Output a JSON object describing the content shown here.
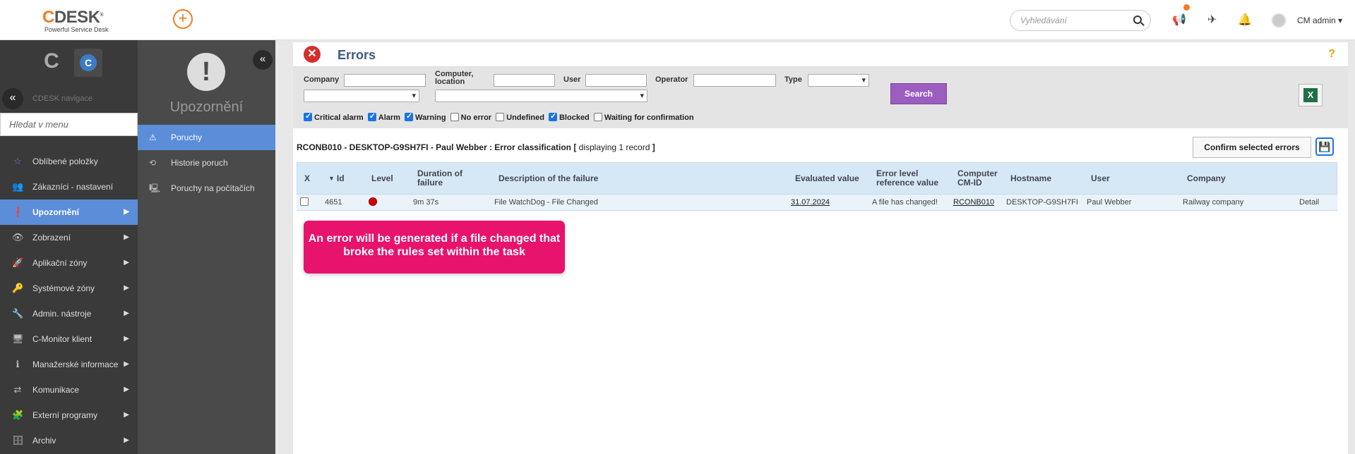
{
  "topbar": {
    "logo_main": "DESK",
    "logo_c": "C",
    "logo_sub": "Powerful Service Desk",
    "search_placeholder": "Vyhledávání",
    "user_name": "CM admin ▾"
  },
  "sidebar": {
    "nav_label": "CDESK navigace",
    "search_placeholder": "Hledat v menu",
    "items": [
      {
        "label": "Oblíbené položky",
        "icon": "star-icon"
      },
      {
        "label": "Zákazníci - nastavení",
        "icon": "users-icon"
      },
      {
        "label": "Upozornění",
        "icon": "alert-icon"
      },
      {
        "label": "Zobrazení",
        "icon": "eye-icon"
      },
      {
        "label": "Aplikační zóny",
        "icon": "rocket-icon"
      },
      {
        "label": "Systémové zóny",
        "icon": "key-icon"
      },
      {
        "label": "Admin. nástroje",
        "icon": "wrench-icon"
      },
      {
        "label": "C-Monitor klient",
        "icon": "monitor-icon"
      },
      {
        "label": "Manažerské informace",
        "icon": "info-icon"
      },
      {
        "label": "Komunikace",
        "icon": "exchange-icon"
      },
      {
        "label": "Externí programy",
        "icon": "puzzle-icon"
      },
      {
        "label": "Archiv",
        "icon": "archive-icon"
      }
    ]
  },
  "sidebar2": {
    "title": "Upozornění",
    "items": [
      {
        "label": "Poruchy"
      },
      {
        "label": "Historie poruch"
      },
      {
        "label": "Poruchy na počítačích"
      }
    ]
  },
  "page": {
    "title": "Errors",
    "help": "?"
  },
  "filters": {
    "company_label": "Company",
    "computer_label": "Computer, location",
    "user_label": "User",
    "operator_label": "Operator",
    "type_label": "Type",
    "search_button": "Search",
    "checkboxes": [
      {
        "label": "Critical alarm",
        "checked": true
      },
      {
        "label": "Alarm",
        "checked": true
      },
      {
        "label": "Warning",
        "checked": true
      },
      {
        "label": "No error",
        "checked": false
      },
      {
        "label": "Undefined",
        "checked": false
      },
      {
        "label": "Blocked",
        "checked": true
      },
      {
        "label": "Waiting for confirmation",
        "checked": false
      }
    ]
  },
  "summary": {
    "text": "RCONB010 - DESKTOP-G9SH7FI - Paul Webber : Error classification [",
    "count": "displaying 1 record",
    "close": "]"
  },
  "actions": {
    "confirm_button": "Confirm selected errors"
  },
  "table": {
    "headers": {
      "x": "X",
      "id": "Id",
      "level": "Level",
      "duration": "Duration of failure",
      "description": "Description of the failure",
      "evaluated": "Evaluated value",
      "error_ref": "Error level reference value",
      "computer": "Computer CM-ID",
      "hostname": "Hostname",
      "user": "User",
      "company": "Company"
    },
    "rows": [
      {
        "id": "4651",
        "level_color": "#d50000",
        "duration": "9m 37s",
        "description": "File WatchDog - File Changed",
        "evaluated": "31.07.2024",
        "error_ref": "A file has changed!",
        "computer": "RCONB010",
        "hostname": "DESKTOP-G9SH7FI",
        "user": "Paul Webber",
        "company": "Railway company",
        "detail": "Detail"
      }
    ]
  },
  "tooltip": {
    "text": "An error will be generated if a file changed that broke the rules set within the task"
  }
}
